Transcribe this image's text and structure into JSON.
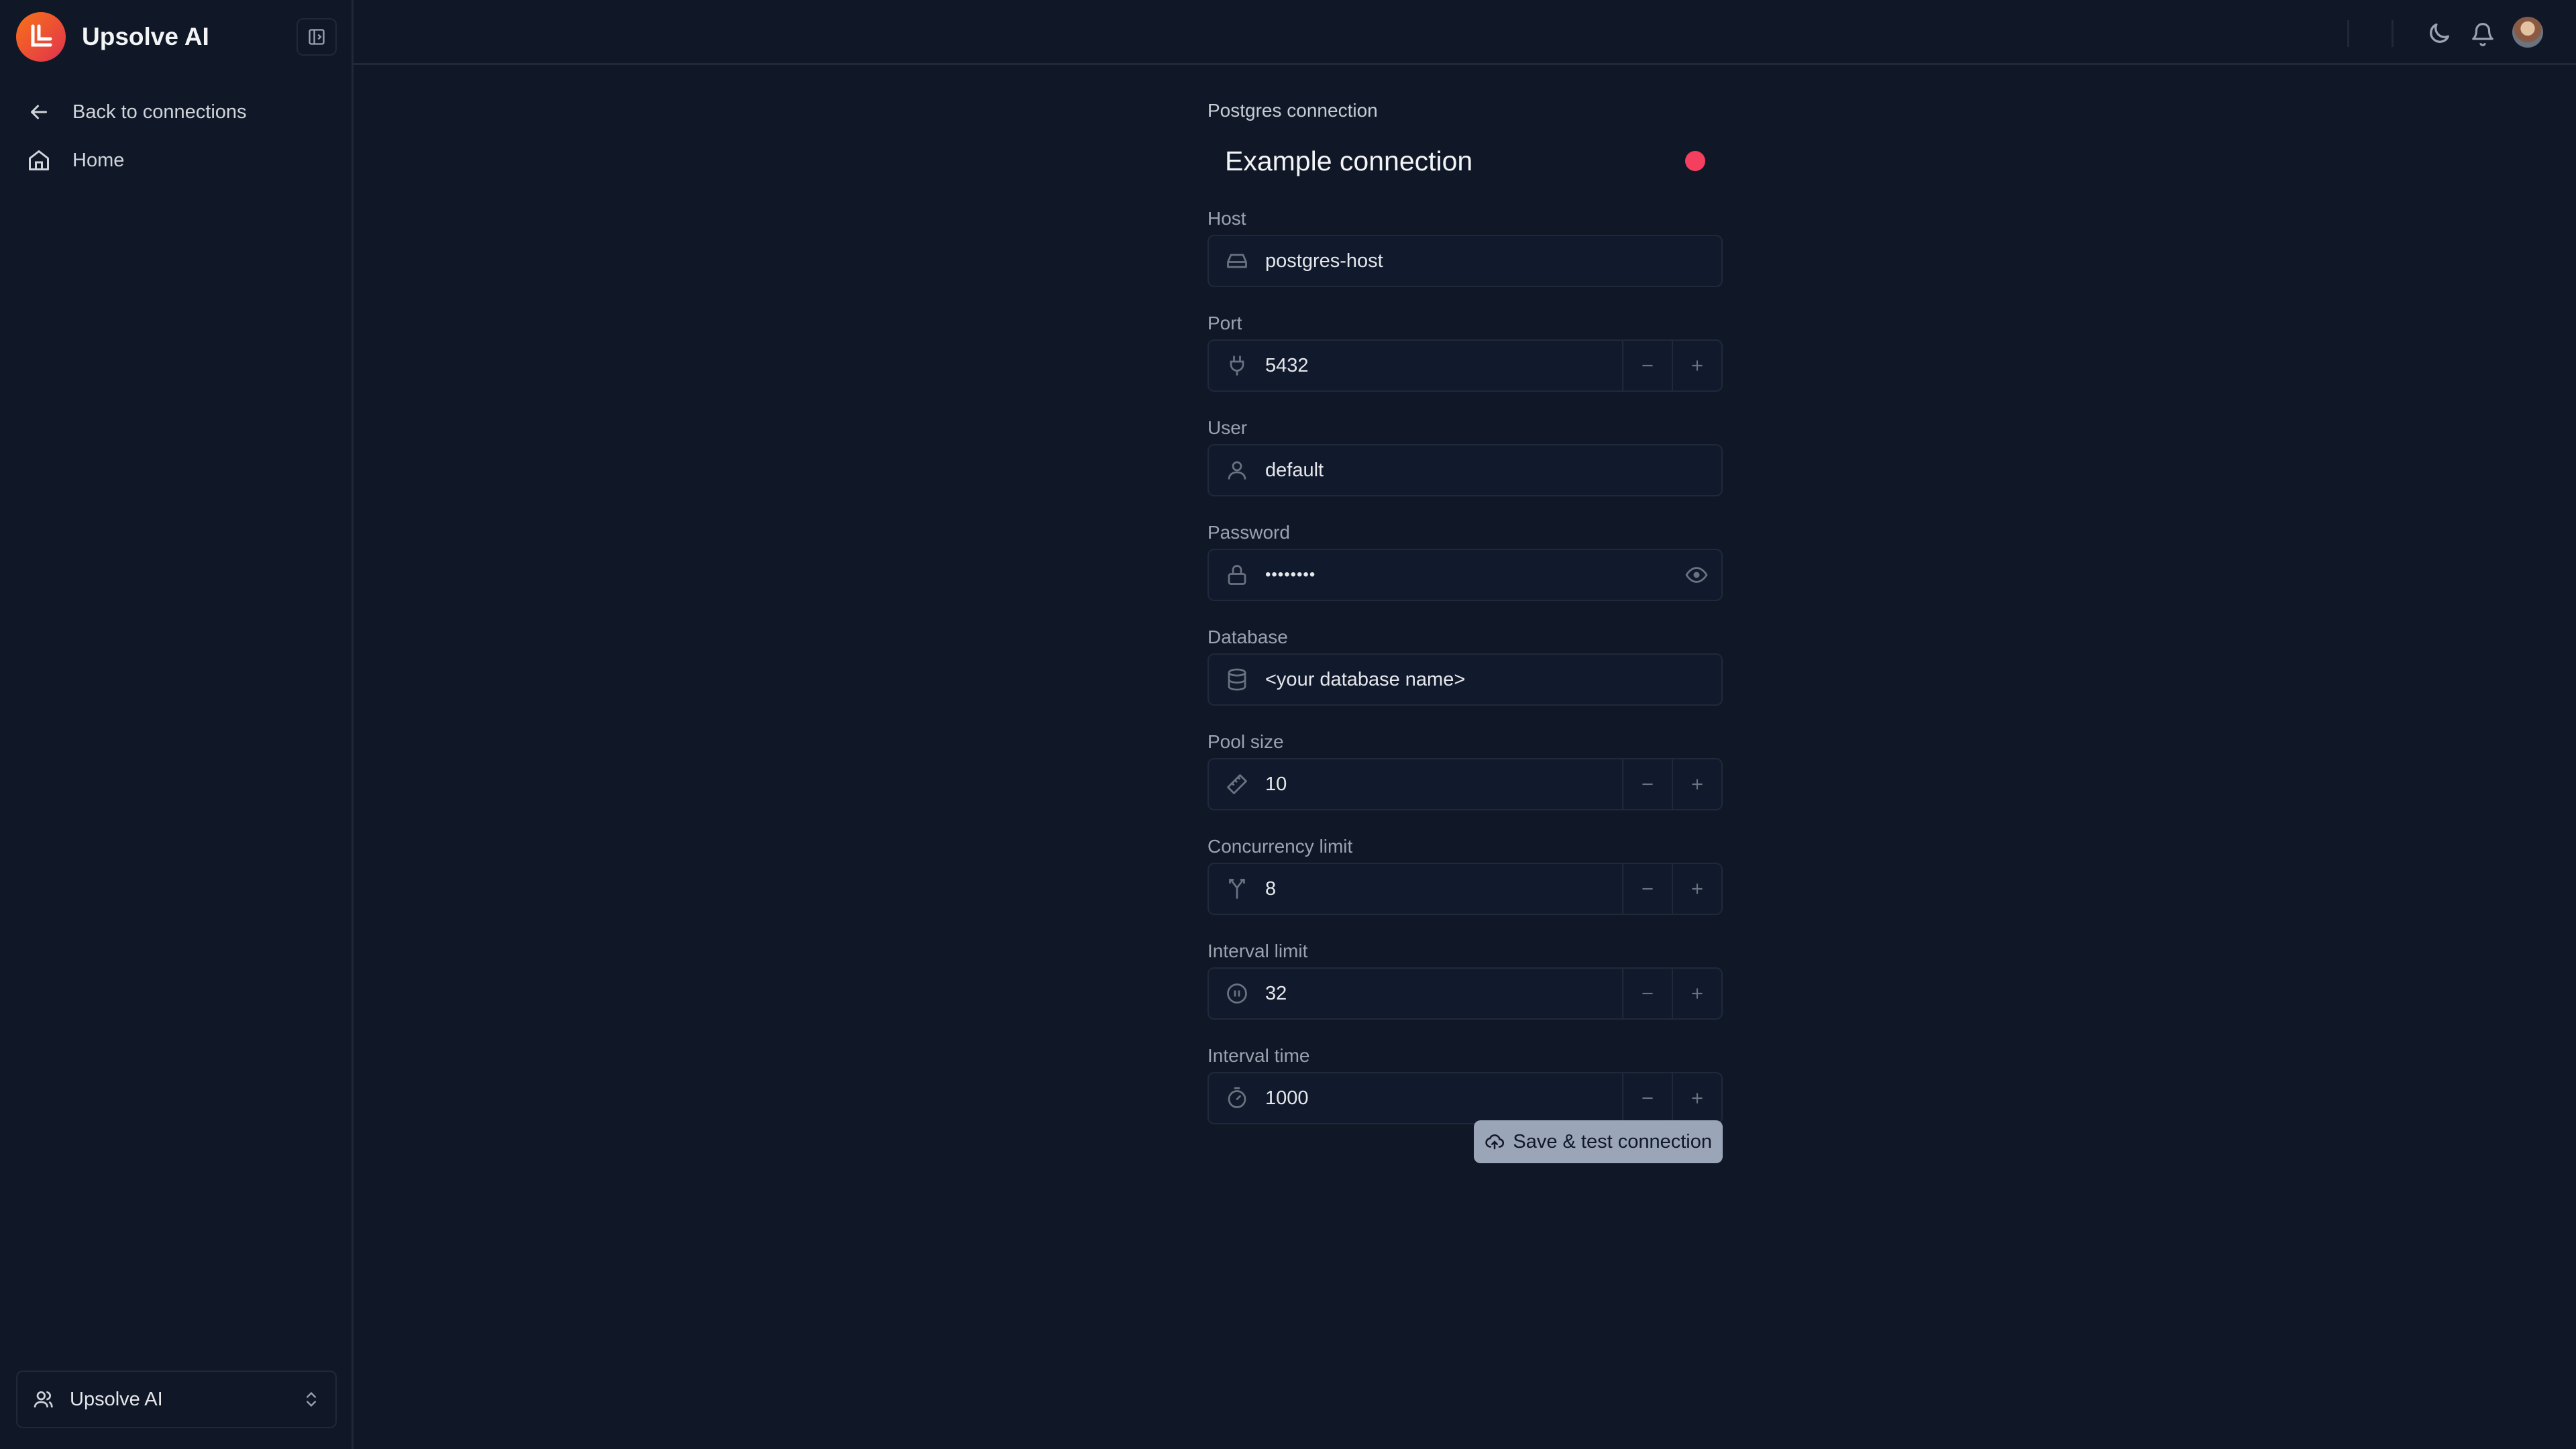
{
  "app": {
    "name": "Upsolve AI"
  },
  "sidebar": {
    "items": [
      {
        "label": "Back to connections",
        "icon": "arrow-left-icon"
      },
      {
        "label": "Home",
        "icon": "home-icon"
      }
    ],
    "workspace": {
      "label": "Upsolve AI"
    }
  },
  "form": {
    "type_label": "Postgres connection",
    "title": "Example connection",
    "status_color": "#f43f5e",
    "fields": {
      "host": {
        "label": "Host",
        "value": "postgres-host",
        "icon": "server-icon"
      },
      "port": {
        "label": "Port",
        "value": "5432",
        "icon": "plug-icon"
      },
      "user": {
        "label": "User",
        "value": "default",
        "icon": "user-icon"
      },
      "password": {
        "label": "Password",
        "value": "••••••••",
        "icon": "lock-icon"
      },
      "database": {
        "label": "Database",
        "value": "<your database name>",
        "icon": "database-icon"
      },
      "pool_size": {
        "label": "Pool size",
        "value": "10",
        "icon": "ruler-icon"
      },
      "concurrency_limit": {
        "label": "Concurrency limit",
        "value": "8",
        "icon": "split-icon"
      },
      "interval_limit": {
        "label": "Interval limit",
        "value": "32",
        "icon": "pause-circle-icon"
      },
      "interval_time": {
        "label": "Interval time",
        "value": "1000",
        "icon": "timer-icon"
      }
    },
    "save_label": "Save & test connection"
  },
  "colors": {
    "background": "#101828",
    "brand_gradient": [
      "#f97316",
      "#e0314f"
    ],
    "button": "#9aa6b8"
  }
}
